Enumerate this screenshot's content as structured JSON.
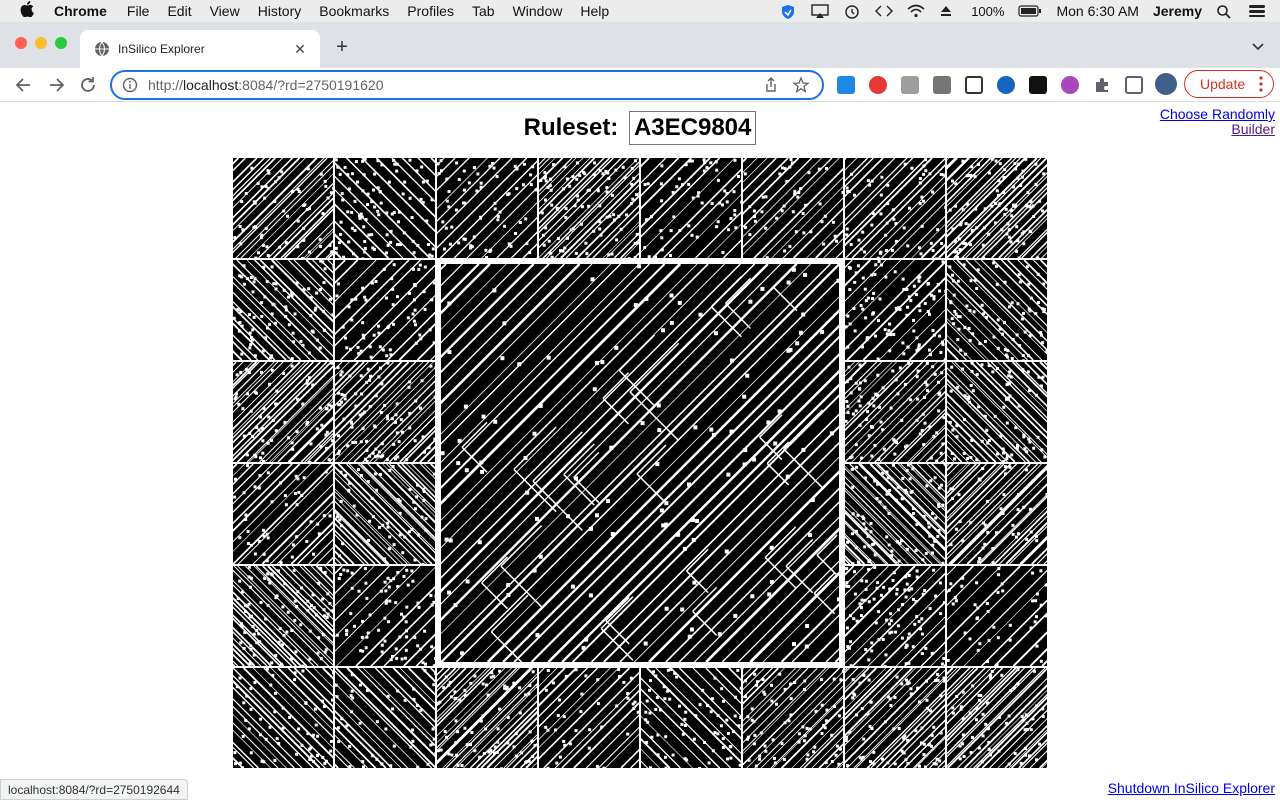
{
  "menubar": {
    "app": "Chrome",
    "items": [
      "File",
      "Edit",
      "View",
      "History",
      "Bookmarks",
      "Profiles",
      "Tab",
      "Window",
      "Help"
    ],
    "battery": "100%",
    "clock": "Mon 6:30 AM",
    "user": "Jeremy"
  },
  "browser": {
    "tab_title": "InSilico Explorer",
    "url_prefix": "http://",
    "url_host": "localhost",
    "url_rest": ":8084/?rd=2750191620",
    "update_label": "Update",
    "status_url": "localhost:8084/?rd=2750192644"
  },
  "page": {
    "ruleset_label": "Ruleset:",
    "ruleset_value": "A3EC9804",
    "choose_randomly": "Choose Randomly",
    "builder": "Builder",
    "shutdown": "Shutdown InSilico Explorer"
  },
  "colors": {
    "accent": "#1a73e8",
    "update_red": "#d93025",
    "link": "#0000ee",
    "link_visited": "#551a8b"
  }
}
